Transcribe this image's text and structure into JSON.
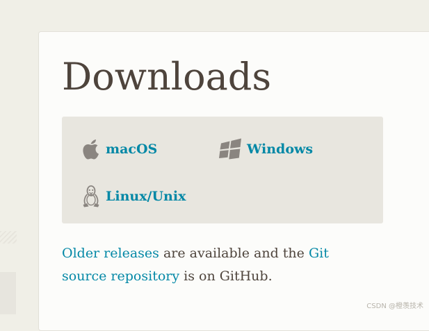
{
  "page": {
    "title": "Downloads"
  },
  "downloads": {
    "items": [
      {
        "label": "macOS",
        "icon": "apple-icon"
      },
      {
        "label": "Windows",
        "icon": "windows-icon"
      },
      {
        "label": "Linux/Unix",
        "icon": "tux-icon"
      }
    ]
  },
  "info": {
    "older_releases_link": "Older releases",
    "text_1": " are available and the ",
    "git_source_link_1": "Git",
    "git_source_link_2": "source repository",
    "text_2": " is on GitHub."
  },
  "watermark": "CSDN @橙羡技术",
  "colors": {
    "link": "#0388a6",
    "text": "#4e443c",
    "panel": "#e8e6df",
    "background": "#f0efe7",
    "card": "#fcfcfa",
    "icon": "#8a8580"
  }
}
